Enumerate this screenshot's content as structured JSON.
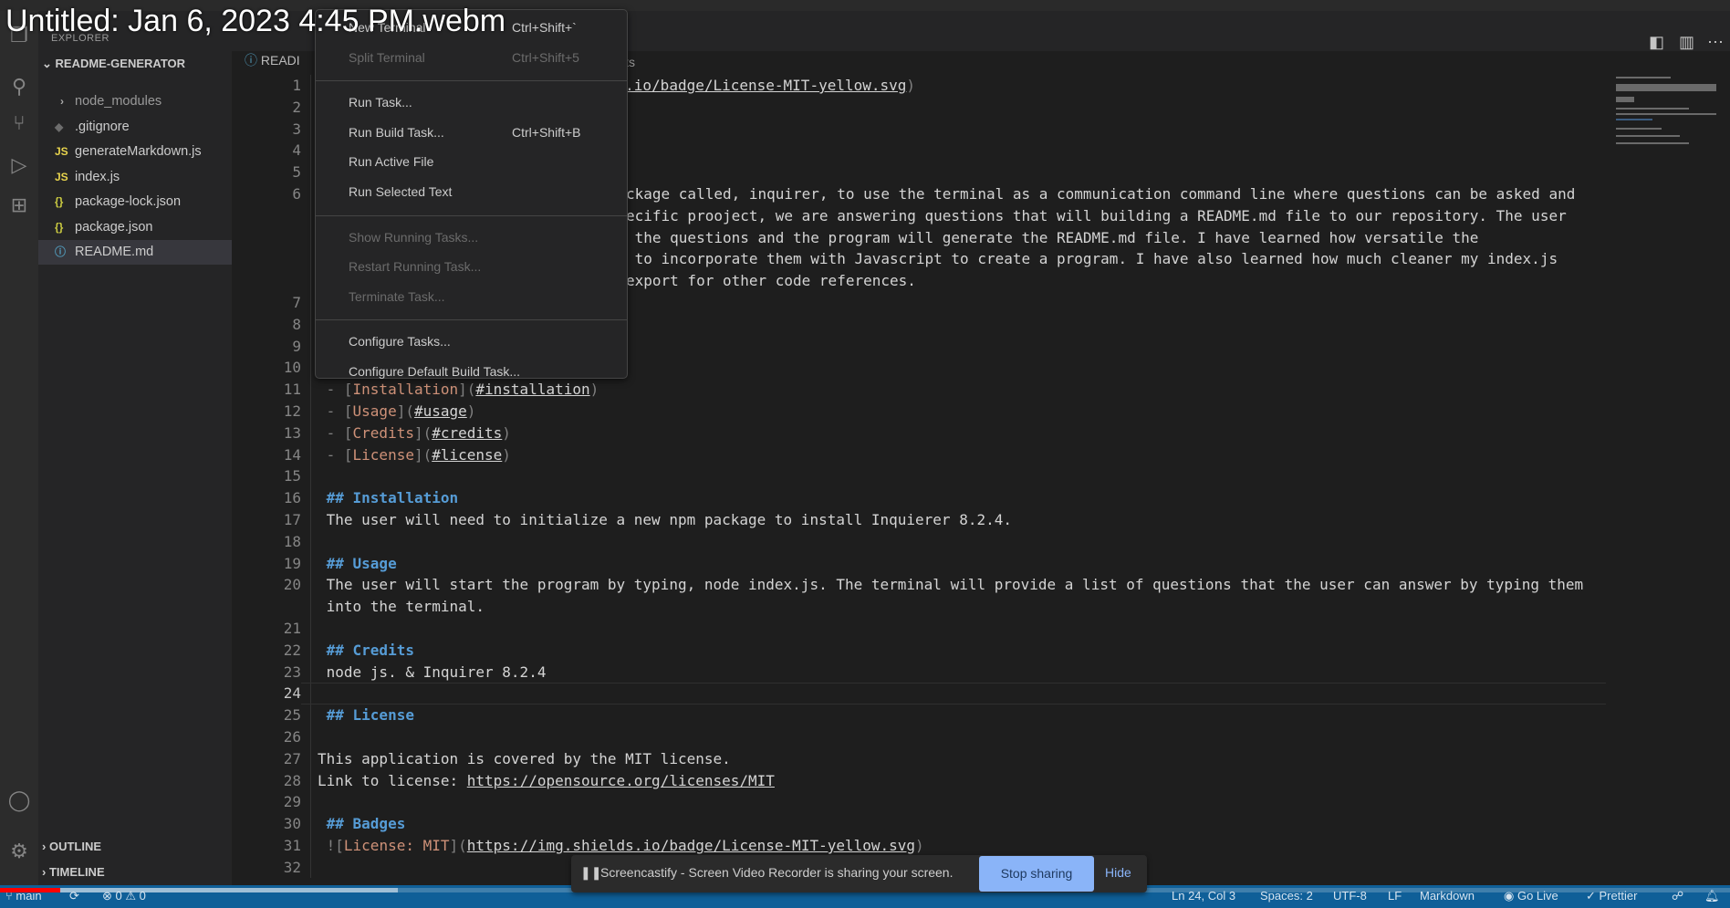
{
  "video_title": "Untitled: Jan 6, 2023 4:45 PM.webm",
  "video_progress_percent": 3.5,
  "video_buffered_percent": 23,
  "colors": {
    "status_bar": "#0f5f98",
    "heading": "#569cd6",
    "link_text": "#ce9178",
    "progress": "#ff0000"
  },
  "sidebar": {
    "explorer_title": "EXPLORER",
    "project": "README-GENERATOR",
    "items": [
      {
        "label": "node_modules",
        "icon": "chevron-right-icon",
        "icon_glyph": "›"
      },
      {
        "label": ".gitignore",
        "icon": "gitignore-icon",
        "icon_glyph": "◆"
      },
      {
        "label": "generateMarkdown.js",
        "icon": "js-file-icon",
        "icon_glyph": "JS"
      },
      {
        "label": "index.js",
        "icon": "js-file-icon",
        "icon_glyph": "JS"
      },
      {
        "label": "package-lock.json",
        "icon": "json-file-icon",
        "icon_glyph": "{}"
      },
      {
        "label": "package.json",
        "icon": "json-file-icon",
        "icon_glyph": "{}"
      },
      {
        "label": "README.md",
        "icon": "info-file-icon",
        "icon_glyph": "ⓘ"
      }
    ],
    "outline": "OUTLINE",
    "timeline": "TIMELINE"
  },
  "editor": {
    "tab": "READI",
    "breadcrumb_fragment": "its",
    "rows": [
      {
        "n": "1",
        "segs": [
          {
            "t": "![",
            "c": "p"
          },
          {
            "t": "License: MIT",
            "c": "r"
          },
          {
            "t": "](",
            "c": "p"
          },
          {
            "t": "https://img.shields.io/badge/License-MIT-yellow.svg",
            "c": "u"
          },
          {
            "t": ")",
            "c": "p"
          }
        ]
      },
      {
        "n": "2",
        "segs": []
      },
      {
        "n": "3",
        "segs": []
      },
      {
        "n": "4",
        "segs": []
      },
      {
        "n": "5",
        "segs": []
      },
      {
        "n": "6",
        "frag": true,
        "segs": [
          {
            "t": "ckage called, inquirer, to use the terminal as a communication command line where questions can be asked and",
            "c": ""
          }
        ]
      },
      {
        "n": "",
        "frag": true,
        "segs": [
          {
            "t": "ecific prooject, we are answering questions that will building a README.md file to our repository. The user",
            "c": ""
          }
        ]
      },
      {
        "n": "",
        "frag": true,
        "segs": [
          {
            "t": " the questions and the program will generate the README.md file. I have learned how versatile the",
            "c": ""
          }
        ]
      },
      {
        "n": "",
        "frag": true,
        "segs": [
          {
            "t": " to incorporate them with Javascript to create a program. I have also learned how much cleaner my index.js",
            "c": ""
          }
        ]
      },
      {
        "n": "",
        "frag": true,
        "segs": [
          {
            "t": "export for other code references.",
            "c": ""
          }
        ]
      },
      {
        "n": "7",
        "segs": []
      },
      {
        "n": "8",
        "segs": []
      },
      {
        "n": "9",
        "segs": []
      },
      {
        "n": "10",
        "segs": []
      },
      {
        "n": "11",
        "segs": [
          {
            "t": " - [",
            "c": "p"
          },
          {
            "t": "Installation",
            "c": "r"
          },
          {
            "t": "](",
            "c": "p"
          },
          {
            "t": "#installation",
            "c": "u"
          },
          {
            "t": ")",
            "c": "p"
          }
        ]
      },
      {
        "n": "12",
        "segs": [
          {
            "t": " - [",
            "c": "p"
          },
          {
            "t": "Usage",
            "c": "r"
          },
          {
            "t": "](",
            "c": "p"
          },
          {
            "t": "#usage",
            "c": "u"
          },
          {
            "t": ")",
            "c": "p"
          }
        ]
      },
      {
        "n": "13",
        "segs": [
          {
            "t": " - [",
            "c": "p"
          },
          {
            "t": "Credits",
            "c": "r"
          },
          {
            "t": "](",
            "c": "p"
          },
          {
            "t": "#credits",
            "c": "u"
          },
          {
            "t": ")",
            "c": "p"
          }
        ]
      },
      {
        "n": "14",
        "segs": [
          {
            "t": " - [",
            "c": "p"
          },
          {
            "t": "License",
            "c": "r"
          },
          {
            "t": "](",
            "c": "p"
          },
          {
            "t": "#license",
            "c": "u"
          },
          {
            "t": ")",
            "c": "p"
          }
        ]
      },
      {
        "n": "15",
        "segs": []
      },
      {
        "n": "16",
        "segs": [
          {
            "t": " ## Installation",
            "c": "h"
          }
        ]
      },
      {
        "n": "17",
        "segs": [
          {
            "t": " The user will need to initialize a new npm package to install Inquierer 8.2.4.",
            "c": ""
          }
        ]
      },
      {
        "n": "18",
        "segs": []
      },
      {
        "n": "19",
        "segs": [
          {
            "t": " ## Usage",
            "c": "h"
          }
        ]
      },
      {
        "n": "20",
        "segs": [
          {
            "t": " The user will start the program by typing, node index.js. The terminal will provide a list of questions that the user can answer by typing them",
            "c": ""
          }
        ]
      },
      {
        "n": "",
        "segs": [
          {
            "t": " into the terminal.",
            "c": ""
          }
        ]
      },
      {
        "n": "21",
        "segs": []
      },
      {
        "n": "22",
        "segs": [
          {
            "t": " ## Credits",
            "c": "h"
          }
        ]
      },
      {
        "n": "23",
        "segs": [
          {
            "t": " node js. & Inquirer 8.2.4",
            "c": ""
          }
        ]
      },
      {
        "n": "24",
        "current": true,
        "segs": []
      },
      {
        "n": "25",
        "segs": [
          {
            "t": " ## License",
            "c": "h"
          }
        ]
      },
      {
        "n": "26",
        "segs": []
      },
      {
        "n": "27",
        "segs": [
          {
            "t": "This application is covered by the MIT license.",
            "c": ""
          }
        ]
      },
      {
        "n": "28",
        "segs": [
          {
            "t": "Link to license: ",
            "c": ""
          },
          {
            "t": "https://opensource.org/licenses/MIT",
            "c": "u"
          }
        ]
      },
      {
        "n": "29",
        "segs": []
      },
      {
        "n": "30",
        "segs": [
          {
            "t": " ## Badges",
            "c": "h"
          }
        ]
      },
      {
        "n": "31",
        "segs": [
          {
            "t": " ![",
            "c": "p"
          },
          {
            "t": "License: MIT",
            "c": "r"
          },
          {
            "t": "](",
            "c": "p"
          },
          {
            "t": "https://img.shields.io/badge/License-MIT-yellow.svg",
            "c": "u"
          },
          {
            "t": ")",
            "c": "p"
          }
        ]
      },
      {
        "n": "32",
        "segs": []
      }
    ]
  },
  "terminal_menu": {
    "items": [
      {
        "label": "New Terminal",
        "shortcut": "Ctrl+Shift+`",
        "disabled": false
      },
      {
        "label": "Split Terminal",
        "shortcut": "Ctrl+Shift+5",
        "disabled": true
      },
      {
        "separator": true
      },
      {
        "label": "Run Task...",
        "shortcut": "",
        "disabled": false
      },
      {
        "label": "Run Build Task...",
        "shortcut": "Ctrl+Shift+B",
        "disabled": false
      },
      {
        "label": "Run Active File",
        "shortcut": "",
        "disabled": false
      },
      {
        "label": "Run Selected Text",
        "shortcut": "",
        "disabled": false
      },
      {
        "separator": true
      },
      {
        "label": "Show Running Tasks...",
        "shortcut": "",
        "disabled": true
      },
      {
        "label": "Restart Running Task...",
        "shortcut": "",
        "disabled": true
      },
      {
        "label": "Terminate Task...",
        "shortcut": "",
        "disabled": true
      },
      {
        "separator": true
      },
      {
        "label": "Configure Tasks...",
        "shortcut": "",
        "disabled": false
      },
      {
        "label": "Configure Default Build Task...",
        "shortcut": "",
        "disabled": false
      }
    ]
  },
  "banner": {
    "message": "Screencastify - Screen Video Recorder is sharing your screen.",
    "stop": "Stop sharing",
    "hide": "Hide"
  },
  "status": {
    "branch": "main",
    "errors": "0",
    "warnings": "0",
    "position": "Ln 24, Col 3",
    "spaces": "Spaces: 2",
    "encoding": "UTF-8",
    "eol": "LF",
    "language": "Markdown",
    "go_live": "Go Live",
    "prettier": "Prettier"
  }
}
